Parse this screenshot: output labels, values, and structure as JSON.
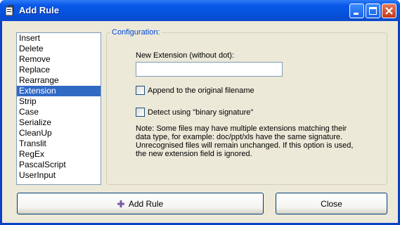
{
  "window": {
    "title": "Add Rule",
    "icon": "app-icon"
  },
  "rules_list": {
    "items": [
      "Insert",
      "Delete",
      "Remove",
      "Replace",
      "Rearrange",
      "Extension",
      "Strip",
      "Case",
      "Serialize",
      "CleanUp",
      "Translit",
      "RegEx",
      "PascalScript",
      "UserInput"
    ],
    "selected": "Extension"
  },
  "config": {
    "group_label": "Configuration:",
    "new_extension_label": "New Extension (without dot):",
    "new_extension_value": "",
    "append_label": "Append to the original filename",
    "append_checked": false,
    "detect_label": "Detect using \"binary signature\"",
    "detect_checked": false,
    "note_line1": "Note: Some files may have multiple extensions matching their",
    "note_line2": "data type, for example: doc/ppt/xls have the same signature.",
    "note_line3": "Unrecognised files will remain unchanged. If this option is used,",
    "note_line4": "the new extension field is ignored."
  },
  "buttons": {
    "add_rule": "Add Rule",
    "close": "Close"
  },
  "colors": {
    "titlebar": "#0A58E8",
    "selection": "#316AC5",
    "group_label": "#0046D5",
    "window_bg": "#ECE9D8"
  }
}
